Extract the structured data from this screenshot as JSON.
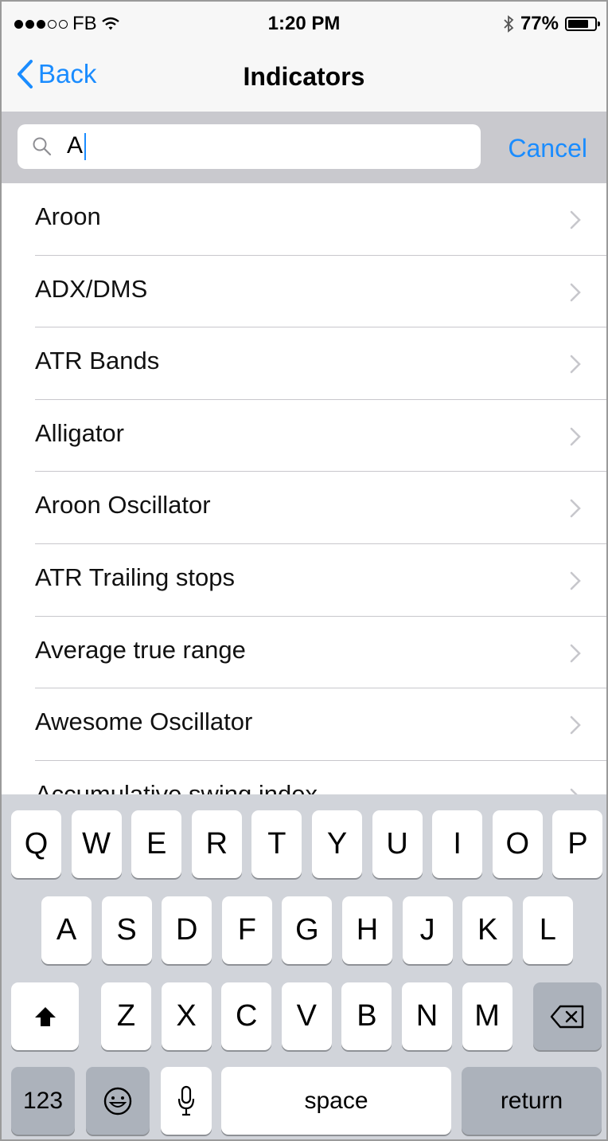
{
  "status_bar": {
    "signal_full": 3,
    "signal_total": 5,
    "carrier": "FB",
    "time": "1:20 PM",
    "battery_percent": "77%",
    "battery_level": 0.77
  },
  "nav": {
    "back_label": "Back",
    "title": "Indicators"
  },
  "search": {
    "value": "A",
    "cancel_label": "Cancel"
  },
  "list_items": [
    "Aroon",
    "ADX/DMS",
    "ATR Bands",
    "Alligator",
    "Aroon Oscillator",
    "ATR Trailing stops",
    "Average true range",
    "Awesome Oscillator",
    "Accumulative swing index"
  ],
  "keyboard": {
    "row1": [
      "Q",
      "W",
      "E",
      "R",
      "T",
      "Y",
      "U",
      "I",
      "O",
      "P"
    ],
    "row2": [
      "A",
      "S",
      "D",
      "F",
      "G",
      "H",
      "J",
      "K",
      "L"
    ],
    "row3": [
      "Z",
      "X",
      "C",
      "V",
      "B",
      "N",
      "M"
    ],
    "numbers_label": "123",
    "space_label": "space",
    "return_label": "return"
  },
  "colors": {
    "accent": "#1a8cff",
    "keyboard_bg": "#d1d4da",
    "search_bar_bg": "#c9c9ce"
  }
}
